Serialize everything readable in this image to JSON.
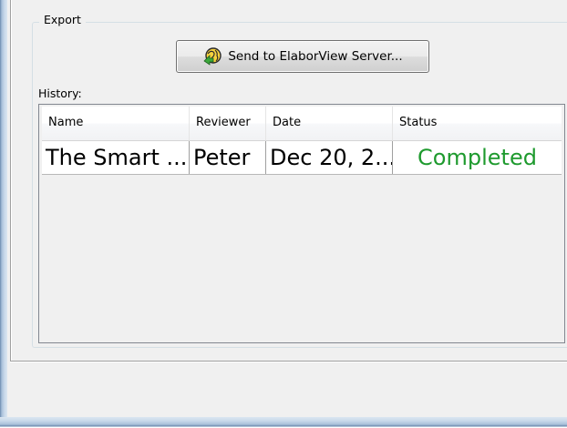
{
  "export_group": {
    "legend": "Export",
    "send_button_label": "Send to ElaborView Server..."
  },
  "history": {
    "label": "History:",
    "columns": [
      "Name",
      "Reviewer",
      "Date",
      "Status"
    ],
    "rows": [
      {
        "name": "The Smart ...",
        "reviewer": "Peter",
        "date": "Dec 20, 2...",
        "status": "Completed"
      }
    ]
  },
  "colors": {
    "status_completed": "#1e9a2e",
    "grid_border": "#828790",
    "button_border": "#707070",
    "window_frame": "#a9c0da"
  },
  "icons": {
    "send_button_icon": "globe-arrow-icon"
  }
}
